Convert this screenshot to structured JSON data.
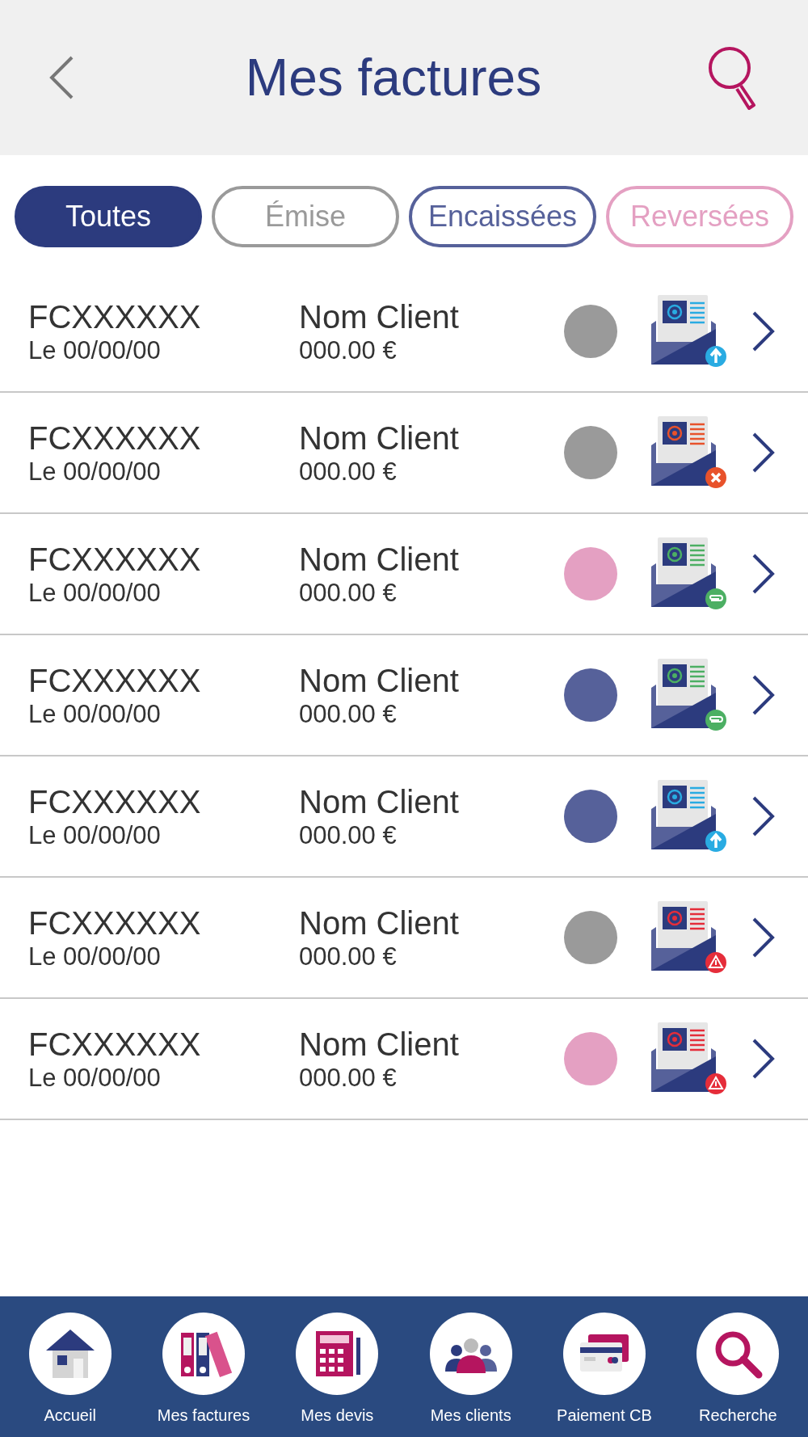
{
  "header": {
    "title": "Mes factures"
  },
  "tabs": [
    {
      "label": "Toutes",
      "selected": true,
      "color": "#2c3b7e"
    },
    {
      "label": "Émise",
      "selected": false,
      "color": "#9a9a9a"
    },
    {
      "label": "Encaissées",
      "selected": false,
      "color": "#56619a"
    },
    {
      "label": "Reversées",
      "selected": false,
      "color": "#e4a0c2"
    }
  ],
  "invoices": [
    {
      "number": "FCXXXXXX",
      "date": "Le 00/00/00",
      "client": "Nom Client",
      "amount": "000.00 €",
      "color": "#9a9a9a",
      "kind": "sent"
    },
    {
      "number": "FCXXXXXX",
      "date": "Le 00/00/00",
      "client": "Nom Client",
      "amount": "000.00 €",
      "color": "#9a9a9a",
      "kind": "failed"
    },
    {
      "number": "FCXXXXXX",
      "date": "Le 00/00/00",
      "client": "Nom Client",
      "amount": "000.00 €",
      "color": "#e4a0c2",
      "kind": "attached"
    },
    {
      "number": "FCXXXXXX",
      "date": "Le 00/00/00",
      "client": "Nom Client",
      "amount": "000.00 €",
      "color": "#56619a",
      "kind": "attached"
    },
    {
      "number": "FCXXXXXX",
      "date": "Le 00/00/00",
      "client": "Nom Client",
      "amount": "000.00 €",
      "color": "#56619a",
      "kind": "sent"
    },
    {
      "number": "FCXXXXXX",
      "date": "Le 00/00/00",
      "client": "Nom Client",
      "amount": "000.00 €",
      "color": "#9a9a9a",
      "kind": "warning"
    },
    {
      "number": "FCXXXXXX",
      "date": "Le 00/00/00",
      "client": "Nom Client",
      "amount": "000.00 €",
      "color": "#e4a0c2",
      "kind": "warning"
    }
  ],
  "bottom_nav": [
    {
      "label": "Accueil",
      "kind": "home"
    },
    {
      "label": "Mes factures",
      "kind": "binders"
    },
    {
      "label": "Mes devis",
      "kind": "calculator"
    },
    {
      "label": "Mes clients",
      "kind": "people"
    },
    {
      "label": "Paiement CB",
      "kind": "card"
    },
    {
      "label": "Recherche",
      "kind": "search"
    }
  ]
}
